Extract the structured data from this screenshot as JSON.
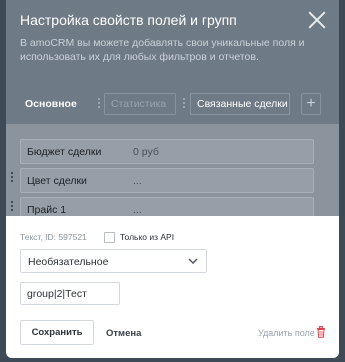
{
  "header": {
    "title": "Настройка свойств полей и групп",
    "description": "В amoCRM вы можете добавлять свои уникальные поля и использовать их для любых фильтров и отчетов.",
    "close_icon": "close-icon"
  },
  "tabs": [
    {
      "label": "Основное"
    },
    {
      "label": "Статистика"
    },
    {
      "label": "Связанные сделки"
    }
  ],
  "add_tab_label": "+",
  "fields": [
    {
      "label": "Бюджет сделки",
      "value": "0 руб"
    },
    {
      "label": "Цвет сделки",
      "value": "..."
    },
    {
      "label": "Прайс 1",
      "value": "..."
    }
  ],
  "editor": {
    "field_id": "Текст, ID: 597521",
    "api_only_label": "Только из API",
    "api_only_checked": false,
    "requirement_select": "Необязательное",
    "name_value": "group|2|Тест",
    "save_label": "Сохранить",
    "cancel_label": "Отмена",
    "delete_label": "Удалить поле"
  },
  "colors": {
    "accent_delete": "#e0404a",
    "overlay": "#6e7a85"
  }
}
